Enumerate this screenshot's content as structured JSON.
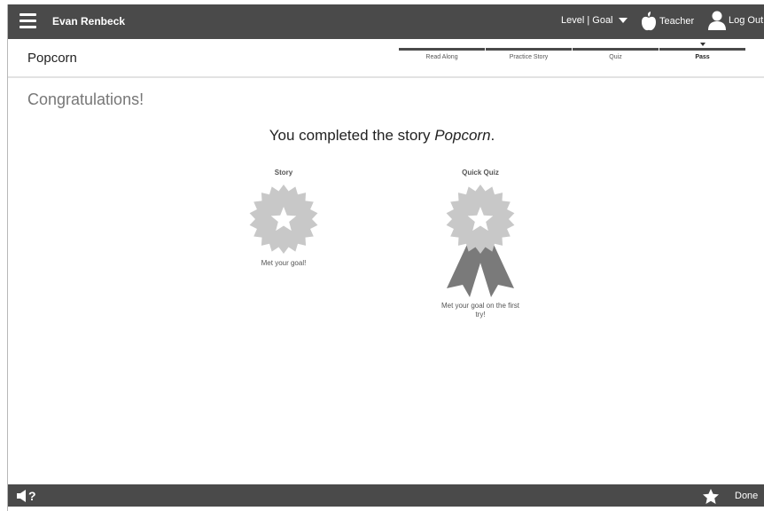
{
  "header": {
    "user_name": "Evan Renbeck",
    "level_goal_label": "Level | Goal",
    "teacher_label": "Teacher",
    "logout_label": "Log Out"
  },
  "story": {
    "title": "Popcorn"
  },
  "steps": [
    {
      "label": "Read Along",
      "active": false
    },
    {
      "label": "Practice Story",
      "active": false
    },
    {
      "label": "Quiz",
      "active": false
    },
    {
      "label": "Pass",
      "active": true
    }
  ],
  "main": {
    "congrats": "Congratulations!",
    "completed_prefix": "You completed the story ",
    "completed_story": "Popcorn",
    "completed_suffix": "."
  },
  "awards": [
    {
      "title": "Story",
      "caption": "Met your goal!",
      "ribbon": false
    },
    {
      "title": "Quick Quiz",
      "caption": "Met your goal on the first try!",
      "ribbon": true
    }
  ],
  "footer": {
    "done_label": "Done"
  },
  "colors": {
    "bar": "#4a4a4a",
    "badge": "#c8c8c8",
    "ribbon": "#7a7a7a"
  },
  "icons": [
    "menu-icon",
    "dropdown-caret-icon",
    "apple-icon",
    "user-icon",
    "speaker-help-icon",
    "star-icon"
  ]
}
